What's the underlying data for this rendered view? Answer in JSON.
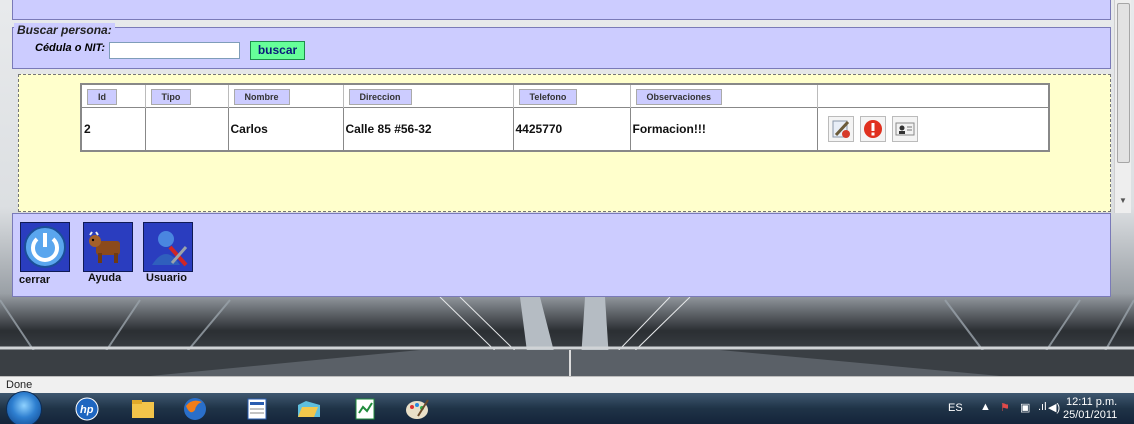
{
  "search": {
    "legend": "Buscar persona:",
    "id_label": "Cédula o NIT:",
    "id_value": "",
    "button_label": "buscar"
  },
  "results": {
    "columns": [
      "Id",
      "Tipo",
      "Nombre",
      "Direccion",
      "Telefono",
      "Observaciones"
    ],
    "rows": [
      {
        "id": "2",
        "tipo": "",
        "nombre": "Carlos",
        "direccion": "Calle 85 #56-32",
        "telefono": "4425770",
        "observaciones": "Formacion!!!",
        "actions": [
          "edit-icon",
          "alert-icon",
          "contact-card-icon"
        ]
      }
    ]
  },
  "toolbar": {
    "buttons": [
      {
        "label": "cerrar",
        "icon": "power-icon"
      },
      {
        "label": "Ayuda",
        "icon": "cow-icon"
      },
      {
        "label": "Usuario",
        "icon": "user-tools-icon"
      }
    ]
  },
  "status": {
    "text": "Done"
  },
  "taskbar": {
    "apps": [
      "start-orb-icon",
      "hp-icon",
      "file-explorer-icon",
      "firefox-icon",
      "word-icon",
      "folder-icon",
      "spreadsheet-icon",
      "paint-icon"
    ],
    "language": "ES",
    "time": "12:11 p.m.",
    "date": "25/01/2011"
  },
  "colors": {
    "panel": "#ccccff",
    "results_bg": "#ffffcc",
    "button_green": "#66ff99",
    "taskbar": "#1f3347"
  }
}
